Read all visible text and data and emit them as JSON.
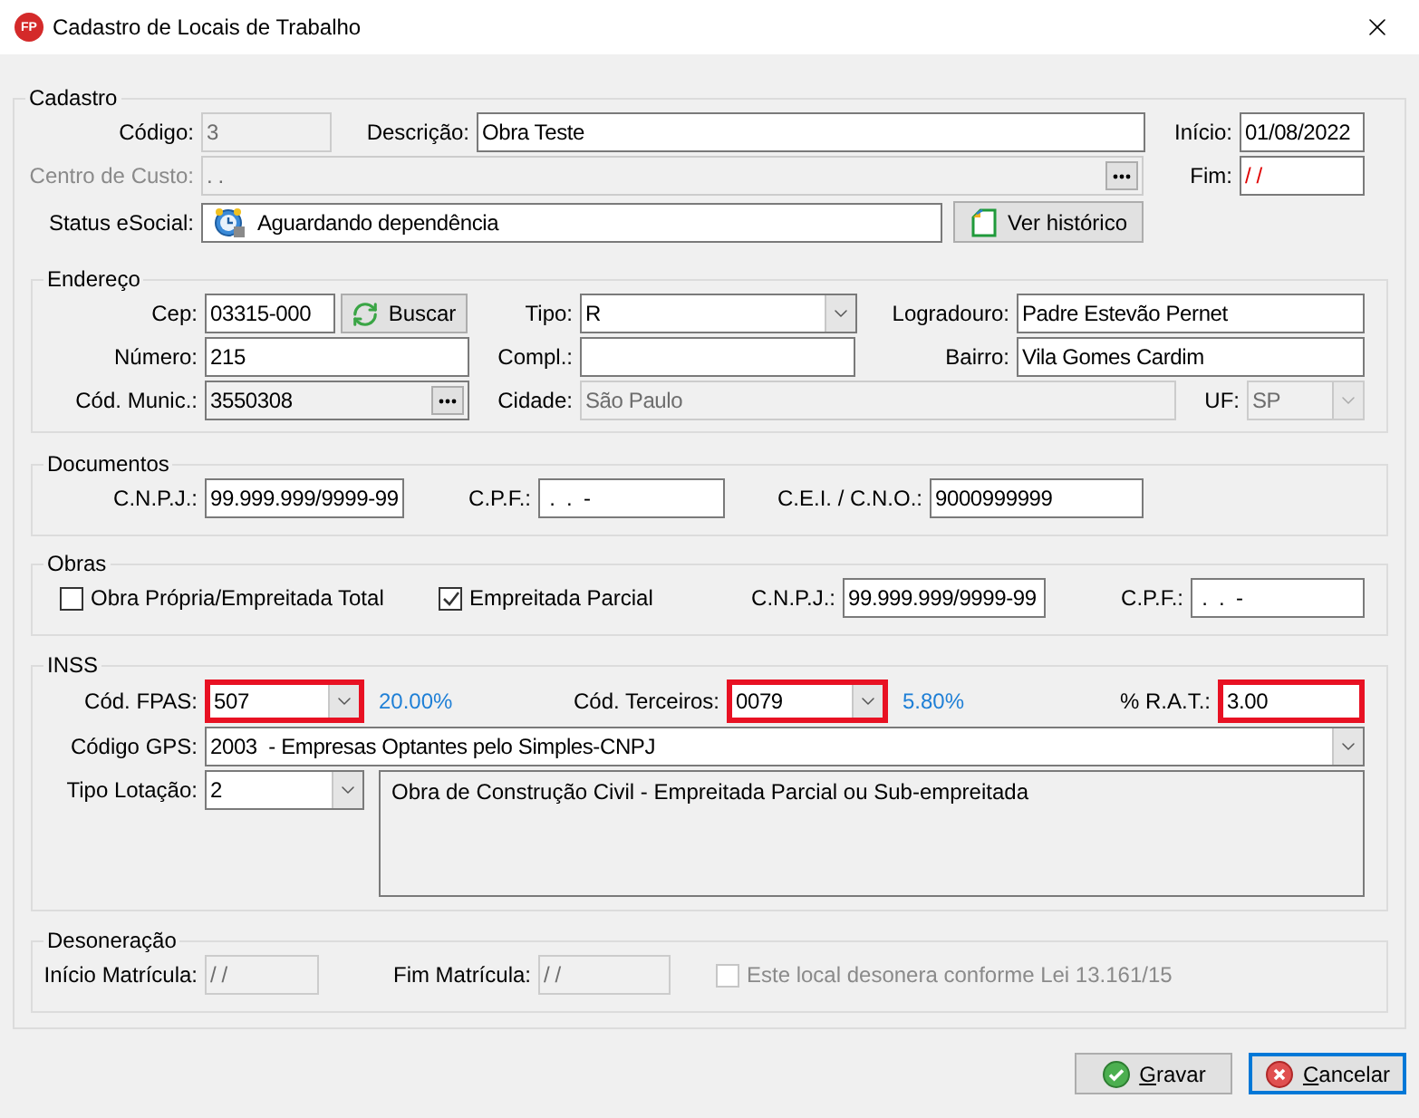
{
  "window": {
    "logo": "FP",
    "title": "Cadastro de Locais de Trabalho"
  },
  "cadastro": {
    "legend": "Cadastro",
    "codigo": {
      "label": "Código:",
      "value": "3",
      "disabled": true
    },
    "descricao": {
      "label": "Descrição:",
      "value": "Obra Teste"
    },
    "inicio": {
      "label": "Início:",
      "value": "01/08/2022"
    },
    "centro_custo": {
      "label": "Centro de Custo:",
      "value": ". .",
      "disabled": true,
      "label_disabled": true
    },
    "fim": {
      "label": "Fim:",
      "value": "/ /",
      "invalid": true
    },
    "status_esocial": {
      "label": "Status eSocial:",
      "value": "Aguardando dependência"
    },
    "ver_historico": "Ver histórico"
  },
  "endereco": {
    "legend": "Endereço",
    "cep": {
      "label": "Cep:",
      "value": "03315-000"
    },
    "buscar": "Buscar",
    "tipo": {
      "label": "Tipo:",
      "value": "R"
    },
    "logradouro": {
      "label": "Logradouro:",
      "value": "Padre Estevão Pernet"
    },
    "numero": {
      "label": "Número:",
      "value": "215"
    },
    "compl": {
      "label": "Compl.:"
    },
    "bairro": {
      "label": "Bairro:",
      "value": "Vila Gomes Cardim"
    },
    "cod_munic": {
      "label": "Cód. Munic.:",
      "value": "3550308",
      "read_only": true
    },
    "cidade": {
      "label": "Cidade:",
      "value": "São Paulo",
      "disabled": true
    },
    "uf": {
      "label": "UF:",
      "value": "SP",
      "disabled": true
    }
  },
  "documentos": {
    "legend": "Documentos",
    "cnpj": {
      "label": "C.N.P.J.:",
      "value": "99.999.999/9999-99"
    },
    "cpf": {
      "label": "C.P.F.:",
      "value": " .  .  -"
    },
    "cei_cno": {
      "label": "C.E.I. / C.N.O.:",
      "value": "9000999999"
    }
  },
  "obras": {
    "legend": "Obras",
    "options": [
      {
        "label": "Obra Própria/Empreitada Total",
        "checked": false
      },
      {
        "label": "Empreitada Parcial",
        "checked": true
      }
    ],
    "cnpj": {
      "label": "C.N.P.J.:",
      "value": "99.999.999/9999-99"
    },
    "cpf": {
      "label": "C.P.F.:",
      "value": " .  .  -"
    }
  },
  "inss": {
    "legend": "INSS",
    "fpas": {
      "label": "Cód. FPAS:",
      "value": "507",
      "highlighted": true,
      "rate": "20.00%"
    },
    "terceiros": {
      "label": "Cód. Terceiros:",
      "value": "0079",
      "highlighted": true,
      "rate": "5.80%"
    },
    "rat": {
      "label": "% R.A.T.:",
      "value": "3.00",
      "highlighted": true
    },
    "gps": {
      "label": "Código GPS:",
      "value": "2003  - Empresas Optantes pelo Simples-CNPJ",
      "highlighted": false
    },
    "tipo_lotacao": {
      "label": "Tipo Lotação:",
      "value": "2",
      "highlighted": false
    },
    "lotacao_descricao": "Obra de Construção Civil - Empreitada Parcial ou Sub-empreitada"
  },
  "desoneracao": {
    "legend": "Desoneração",
    "inicio_matricula": {
      "label": "Início Matrícula:",
      "value": "/ /",
      "disabled": true
    },
    "fim_matricula": {
      "label": "Fim Matrícula:",
      "value": "/ /",
      "disabled": true
    },
    "desonera": {
      "label": "Este local desonera conforme Lei 13.161/15",
      "checked": false,
      "disabled": true
    }
  },
  "buttons": [
    {
      "label": "Gravar",
      "kind": "save",
      "focused": false
    },
    {
      "label": "Cancelar",
      "kind": "cancel",
      "focused": true
    }
  ]
}
